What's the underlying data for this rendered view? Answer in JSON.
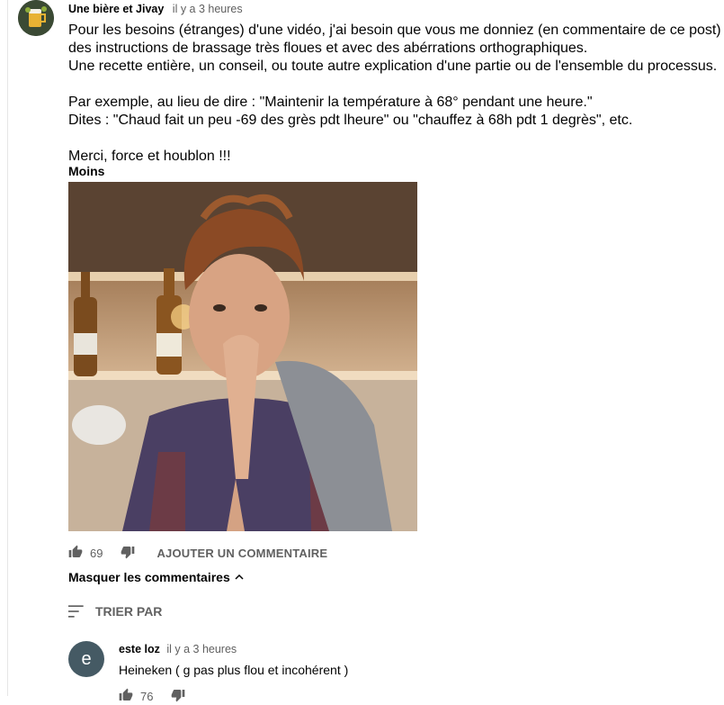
{
  "post": {
    "author": "Une bière et Jivay",
    "time": "il y a 3 heures",
    "lines": [
      "Pour les besoins (étranges) d'une vidéo, j'ai besoin que vous me donniez (en commentaire de ce post)",
      "des instructions de brassage très floues et avec des abérrations orthographiques.",
      "Une recette entière, un conseil, ou toute autre explication d'une partie ou de l'ensemble du processus.",
      "Par exemple, au lieu de dire : \"Maintenir la température à 68° pendant une heure.\"",
      "Dites : \"Chaud fait un peu -69 des grès pdt lheure\" ou \"chauffez à 68h pdt 1 degrès\", etc.",
      "Merci, force et houblon !!!"
    ],
    "less_label": "Moins",
    "likes": "69",
    "reply_label": "AJOUTER UN COMMENTAIRE",
    "hide_replies_label": "Masquer les commentaires",
    "sort_label": "TRIER PAR"
  },
  "reply": {
    "avatar_letter": "e",
    "author": "este loz",
    "time": "il y a 3 heures",
    "text": "Heineken  ( g pas plus flou et incohérent )",
    "likes": "76"
  },
  "colors": {
    "text": "#030303",
    "muted": "#606060",
    "reply_avatar": "#455a64"
  },
  "icons": [
    "thumb-up-icon",
    "thumb-down-icon",
    "chevron-up-icon",
    "sort-icon"
  ]
}
